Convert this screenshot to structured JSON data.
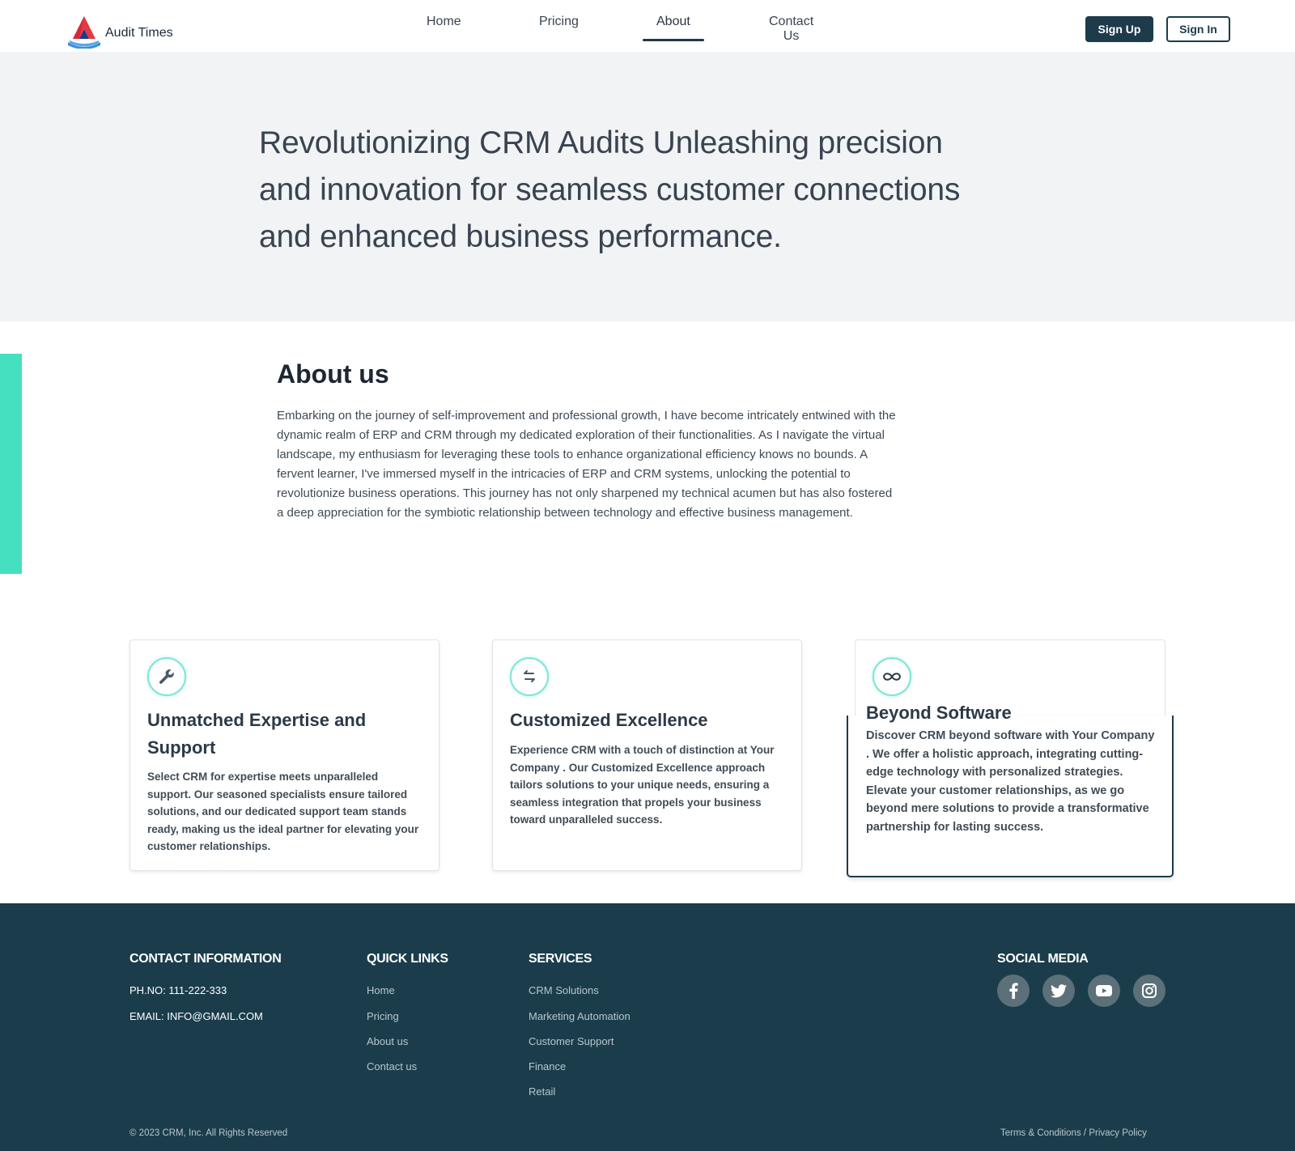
{
  "header": {
    "brand": "Audit Times",
    "nav": [
      {
        "label": "Home"
      },
      {
        "label": "Pricing"
      },
      {
        "label": "About"
      },
      {
        "label": "Contact Us"
      }
    ],
    "active_nav": "About",
    "signup_label": "Sign Up",
    "signin_label": "Sign In"
  },
  "hero": {
    "text": "Revolutionizing CRM Audits Unleashing precision and innovation for seamless customer connections and enhanced business performance."
  },
  "about": {
    "title": "About us",
    "body": "Embarking on the journey of self-improvement and professional growth, I have become intricately entwined with the dynamic realm of ERP and CRM through my dedicated exploration of their functionalities. As I navigate the virtual landscape, my enthusiasm for leveraging these tools to enhance organizational efficiency knows no bounds. A fervent learner, I've immersed myself in the intricacies of ERP and CRM systems, unlocking the potential to revolutionize business operations. This journey has not only sharpened my technical acumen but has also fostered a deep appreciation for the symbiotic relationship between technology and effective business management."
  },
  "cards": [
    {
      "icon": "wrench-icon",
      "title": "Unmatched Expertise and Support",
      "text": "Select CRM for expertise meets unparalleled support. Our seasoned specialists ensure tailored solutions, and our dedicated support team stands ready, making us the ideal partner for elevating your customer relationships."
    },
    {
      "icon": "exchange-icon",
      "title": "Customized Excellence",
      "text": "Experience CRM with a touch of distinction at Your Company . Our Customized Excellence approach tailors solutions to your unique needs, ensuring a seamless integration that propels your business toward unparalleled success."
    },
    {
      "icon": "infinity-icon",
      "title": "Beyond Software",
      "text": "Discover CRM beyond software with Your Company . We offer a holistic approach, integrating cutting-edge technology with personalized strategies. Elevate your customer relationships, as we go beyond mere solutions to provide a transformative partnership for lasting success."
    }
  ],
  "footer": {
    "contact_heading": "CONTACT INFORMATION",
    "phone": "PH.NO: 111-222-333",
    "email": "EMAIL: INFO@GMAIL.COM",
    "links_heading": "QUICK LINKS",
    "links": [
      "Home",
      "Pricing",
      "About us",
      "Contact us"
    ],
    "services_heading": "SERVICES",
    "services": [
      "CRM Solutions",
      "Marketing Automation",
      "Customer Support",
      "Finance",
      "Retail"
    ],
    "social_heading": "SOCIAL MEDIA",
    "social": [
      "facebook-icon",
      "twitter-icon",
      "youtube-icon",
      "instagram-icon"
    ],
    "copyright": "© 2023 CRM, Inc. All Rights Reserved",
    "terms": "Terms & Conditions",
    "privacy": "Privacy Policy"
  },
  "colors": {
    "primary": "#1d3b4b",
    "accent": "#45e0c0",
    "hero_bg": "#f2f3f5",
    "footer_bg": "#1b3d4b"
  }
}
